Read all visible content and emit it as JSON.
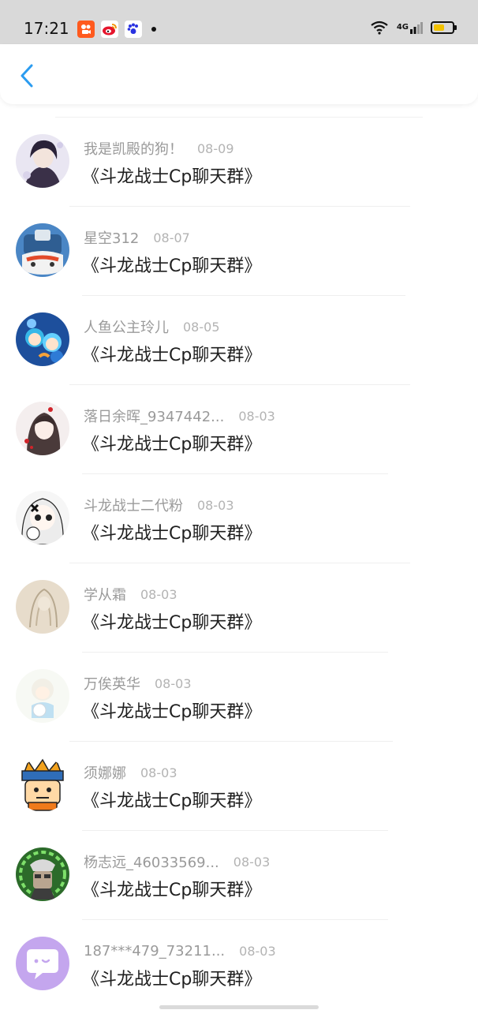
{
  "status_bar": {
    "time": "17:21",
    "network_label": "4G",
    "battery_level": 0.6,
    "battery_color": "#f2c200",
    "icons": [
      "kuaishou-app-icon",
      "weibo-app-icon",
      "baidu-app-icon",
      "notification-dot-icon",
      "wifi-icon",
      "signal-icon",
      "battery-icon"
    ]
  },
  "nav": {
    "back_icon": "chevron-left-icon",
    "accent_color": "#2b9cf0"
  },
  "messages": [
    {
      "name": "我是凯殿的狗！",
      "date": "08-09",
      "title": "《斗龙战士Cp聊天群》"
    },
    {
      "name": "星空312",
      "date": "08-07",
      "title": "《斗龙战士Cp聊天群》"
    },
    {
      "name": "人鱼公主玲儿",
      "date": "08-05",
      "title": "《斗龙战士Cp聊天群》"
    },
    {
      "name": "落日余晖_9347442...",
      "date": "08-03",
      "title": "《斗龙战士Cp聊天群》"
    },
    {
      "name": "斗龙战士二代粉",
      "date": "08-03",
      "title": "《斗龙战士Cp聊天群》"
    },
    {
      "name": "学从霜",
      "date": "08-03",
      "title": "《斗龙战士Cp聊天群》"
    },
    {
      "name": "万俟英华",
      "date": "08-03",
      "title": "《斗龙战士Cp聊天群》"
    },
    {
      "name": "须娜娜",
      "date": "08-03",
      "title": "《斗龙战士Cp聊天群》"
    },
    {
      "name": "杨志远_46033569...",
      "date": "08-03",
      "title": "《斗龙战士Cp聊天群》"
    },
    {
      "name": "187***479_73211...",
      "date": "08-03",
      "title": "《斗龙战士Cp聊天群》"
    }
  ]
}
